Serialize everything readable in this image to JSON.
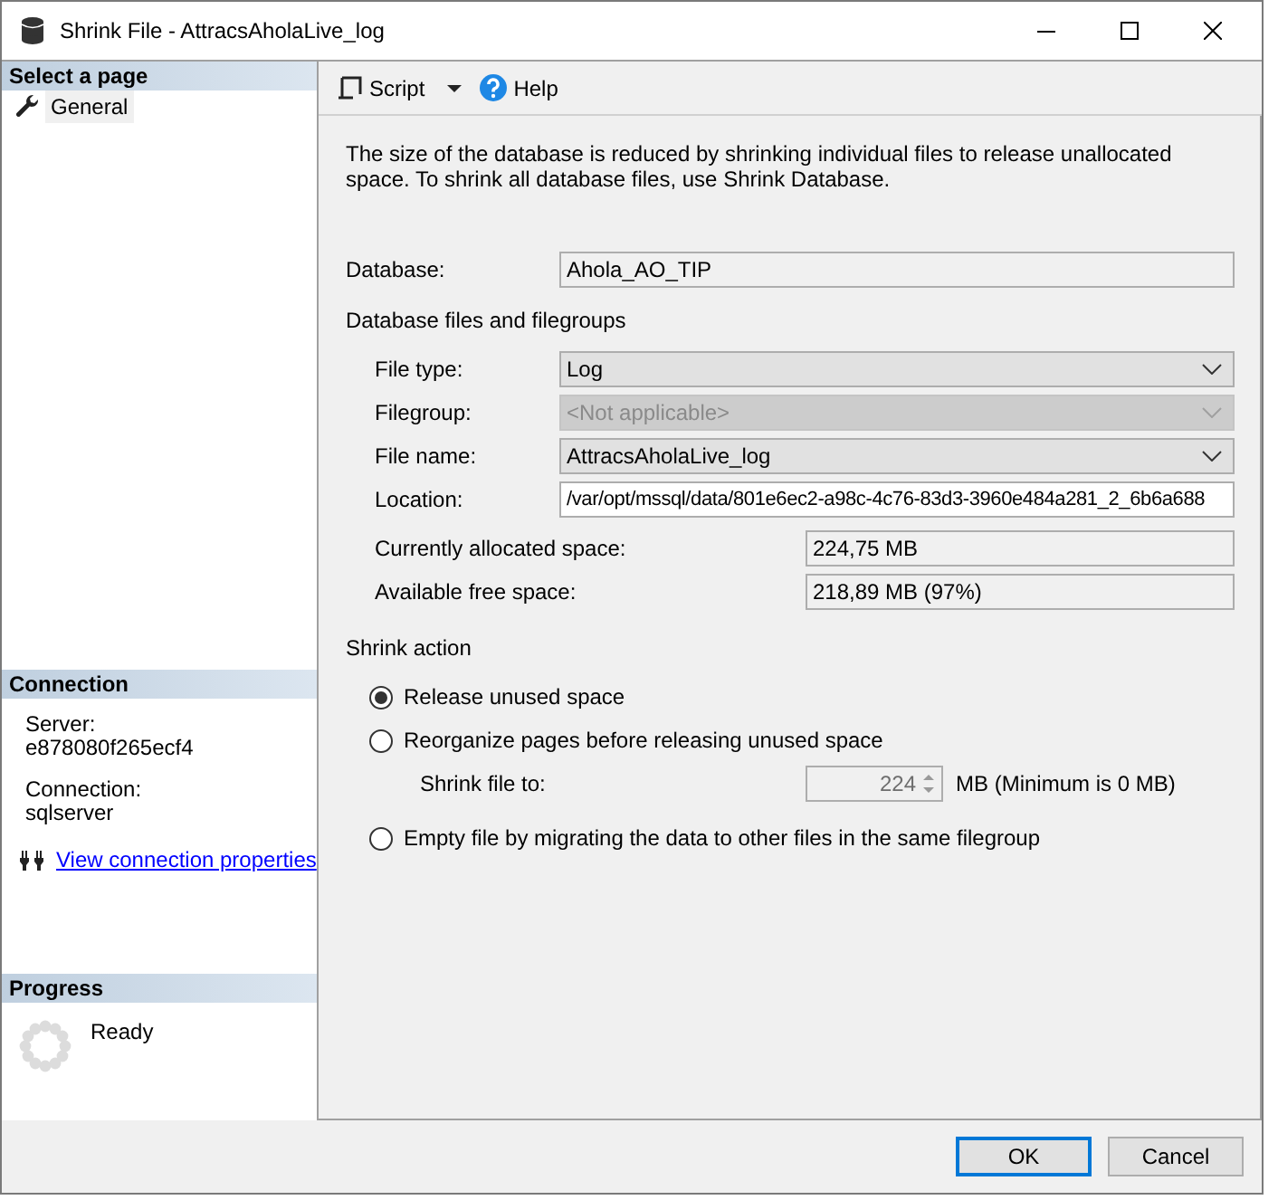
{
  "window": {
    "title": "Shrink File - AttracsAholaLive_log"
  },
  "sidebar": {
    "select_page_header": "Select a page",
    "pages": [
      {
        "label": "General",
        "selected": true
      }
    ],
    "connection_header": "Connection",
    "server_label": "Server:",
    "server": "e878080f265ecf4",
    "connection_label": "Connection:",
    "connection": "sqlserver",
    "link": "View connection properties",
    "progress_header": "Progress",
    "progress_status": "Ready"
  },
  "toolbar": {
    "script": "Script",
    "help": "Help"
  },
  "description": "The size of the database is reduced by shrinking individual files to release unallocated space. To shrink all database files, use Shrink Database.",
  "database": {
    "label": "Database:",
    "value": "Ahola_AO_TIP"
  },
  "files_header": "Database files and filegroups",
  "file_fields": [
    {
      "label": "File type:",
      "value": "Log",
      "kind": "dropdown",
      "disabled": false
    },
    {
      "label": "Filegroup:",
      "value": "<Not applicable>",
      "kind": "dropdown",
      "disabled": true
    },
    {
      "label": "File name:",
      "value": "AttracsAholaLive_log",
      "kind": "dropdown",
      "disabled": false
    },
    {
      "label": "Location:",
      "value": "/var/opt/mssql/data/801e6ec2-a98c-4c76-83d3-3960e484a281_2_6b6a688",
      "kind": "text"
    }
  ],
  "space": [
    {
      "label": "Currently allocated space:",
      "value": "224,75 MB"
    },
    {
      "label": "Available free space:",
      "value": "218,89 MB (97%)"
    }
  ],
  "shrink_action_header": "Shrink action",
  "options": [
    {
      "label": "Release unused space",
      "selected": true
    },
    {
      "label": "Reorganize pages before releasing unused space",
      "selected": false,
      "shrink_to": {
        "label": "Shrink file to:",
        "value": "224",
        "disabled": true,
        "unit": "MB (Minimum is 0 MB)"
      }
    },
    {
      "label": "Empty file by migrating the data to other files in the same filegroup",
      "selected": false
    }
  ],
  "buttons": [
    {
      "label": "OK",
      "default": true
    },
    {
      "label": "Cancel",
      "default": false
    }
  ]
}
